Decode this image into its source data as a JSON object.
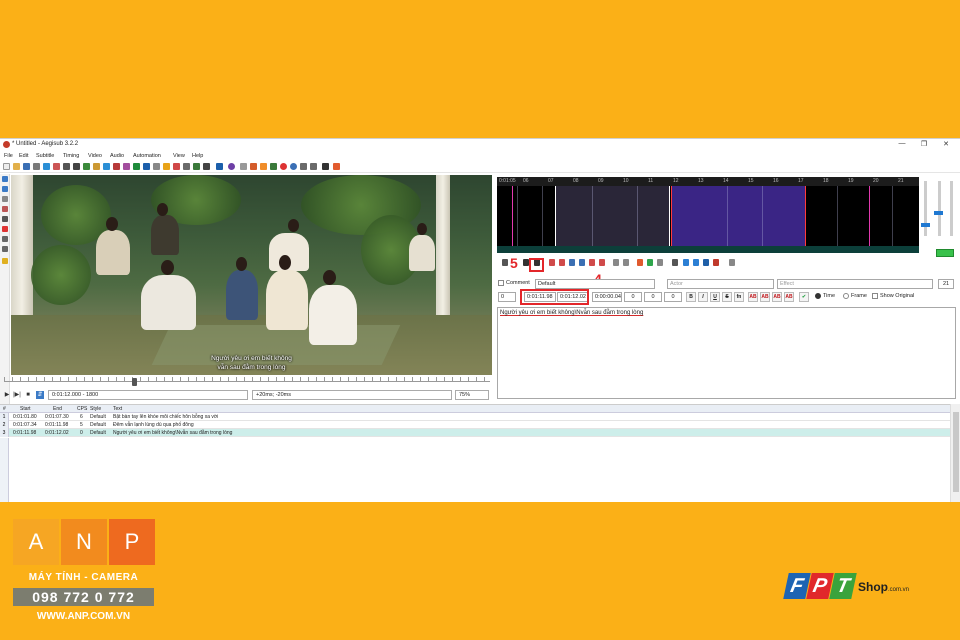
{
  "window": {
    "title": "* Untitled - Aegisub 3.2.2",
    "controls": [
      "—",
      "❐",
      "✕"
    ]
  },
  "menu": [
    "File",
    "Edit",
    "Subtitle",
    "Timing",
    "Video",
    "Audio",
    "Automation",
    "View",
    "Help"
  ],
  "video": {
    "subtitle_line1": "Người yêu ơi em biết không",
    "subtitle_line2": "vẫn sau đằm trong lòng",
    "time_frame": "0:01:12.000 - 1800",
    "offset": "+20ms; -20ms",
    "zoom": "75%"
  },
  "audio": {
    "ruler": [
      "0:01:05",
      "06",
      "07",
      "08",
      "09",
      "10",
      "11",
      "12",
      "13",
      "14",
      "15",
      "16",
      "17",
      "18",
      "19",
      "20",
      "21"
    ]
  },
  "annotations": {
    "step5": "5",
    "step4": "4"
  },
  "edit": {
    "comment_label": "Comment",
    "style_value": "Default",
    "actor_placeholder": "Actor",
    "effect_placeholder": "Effect",
    "char_count": "21",
    "layer": "0",
    "start_time": "0:01:11.98",
    "end_time": "0:01:12.02",
    "duration": "0:00:00.04",
    "margin_l": "0",
    "margin_r": "0",
    "margin_v": "0",
    "format_buttons": [
      "B",
      "I",
      "U",
      "S",
      "fn",
      "AB",
      "AB",
      "AB",
      "AB"
    ],
    "time_label": "Time",
    "frame_label": "Frame",
    "show_original_label": "Show Original",
    "text": "Người yêu ơi em biết không\\Nvẫn sau đằm trong lòng"
  },
  "grid": {
    "headers": [
      "#",
      "Start",
      "End",
      "CPS",
      "Style",
      "Text"
    ],
    "rows": [
      {
        "num": "1",
        "start": "0:01:01.80",
        "end": "0:01:07.30",
        "cps": "6",
        "style": "Default",
        "text": "Bật bàn tay lên khóe môi chiếc hôn bỗng xa vời"
      },
      {
        "num": "2",
        "start": "0:01:07.34",
        "end": "0:01:11.98",
        "cps": "5",
        "style": "Default",
        "text": "Đêm vẫn lạnh lùng dù qua phố đông"
      },
      {
        "num": "3",
        "start": "0:01:11.98",
        "end": "0:01:12.02",
        "cps": "0",
        "style": "Default",
        "text": "Người yêu ơi em biết không\\Nvẫn sau đằm trong lòng"
      }
    ]
  },
  "branding": {
    "anp_letters": [
      "A",
      "N",
      "P"
    ],
    "anp_tagline": "MÁY TÍNH - CAMERA",
    "anp_phone": "098 772 0 772",
    "anp_url": "WWW.ANP.COM.VN",
    "fpt_letters": [
      "F",
      "P",
      "T"
    ],
    "fpt_shop": "Shop",
    "fpt_domain": ".com.vn"
  },
  "colors": {
    "background": "#fbb017",
    "annotation": "#e3262a",
    "selected_row": "#cdeeea",
    "anp_a": "#f6a623",
    "anp_n": "#f28b1e",
    "anp_p": "#ee6a1f",
    "fpt_f": "#1d64b3",
    "fpt_p": "#e1282b",
    "fpt_t": "#3aa33c"
  }
}
